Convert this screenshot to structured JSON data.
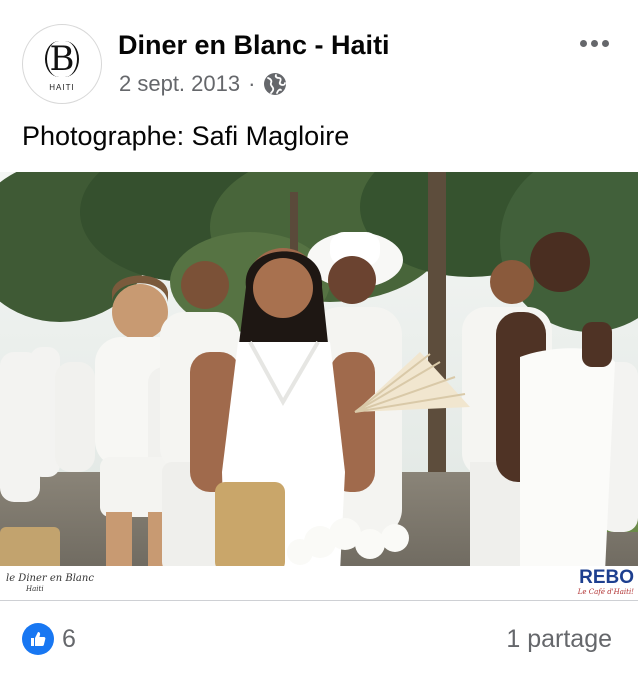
{
  "post": {
    "page_name": "Diner en Blanc - Haiti",
    "date": "2 sept. 2013",
    "separator": "·",
    "audience_icon": "globe-icon",
    "more_icon": "more-options-icon",
    "caption": "Photographe: Safi Magloire"
  },
  "avatar": {
    "monogram": "B",
    "subtitle": "HAITI"
  },
  "photo": {
    "watermark_left_line1": "le Diner en Blanc",
    "watermark_left_line2": "Haiti",
    "sponsor_brand": "REBO",
    "sponsor_tagline": "Le Café d'Haiti!"
  },
  "footer": {
    "reaction_icon": "like-icon",
    "reaction_count": "6",
    "shares": "1 partage"
  },
  "colors": {
    "accent": "#1877f2",
    "secondary_text": "#65676b",
    "primary_text": "#050505",
    "sponsor_blue": "#1d3f8f"
  }
}
